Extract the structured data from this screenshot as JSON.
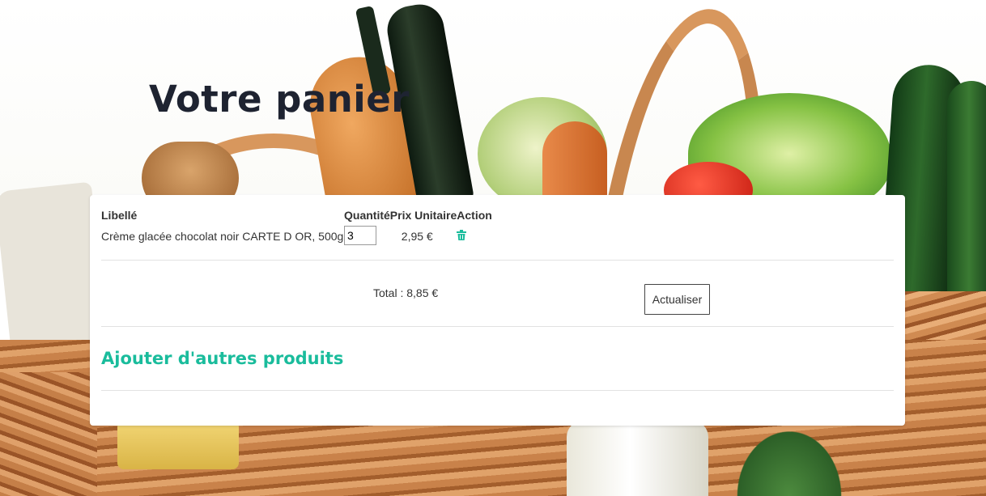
{
  "page": {
    "title": "Votre panier"
  },
  "cart": {
    "headers": {
      "label": "Libellé",
      "quantity": "Quantité",
      "unit_price": "Prix Unitaire",
      "action": "Action"
    },
    "items": [
      {
        "label": "Crème glacée chocolat noir CARTE D OR, 500g",
        "quantity": "3",
        "unit_price": "2,95 €",
        "action_icon": "trash-icon"
      }
    ],
    "total": "Total : 8,85 €",
    "refresh_label": "Actualiser",
    "add_more_label": "Ajouter d'autres produits"
  },
  "colors": {
    "accent": "#1abc9c",
    "title": "#1e2331",
    "text": "#333333"
  }
}
